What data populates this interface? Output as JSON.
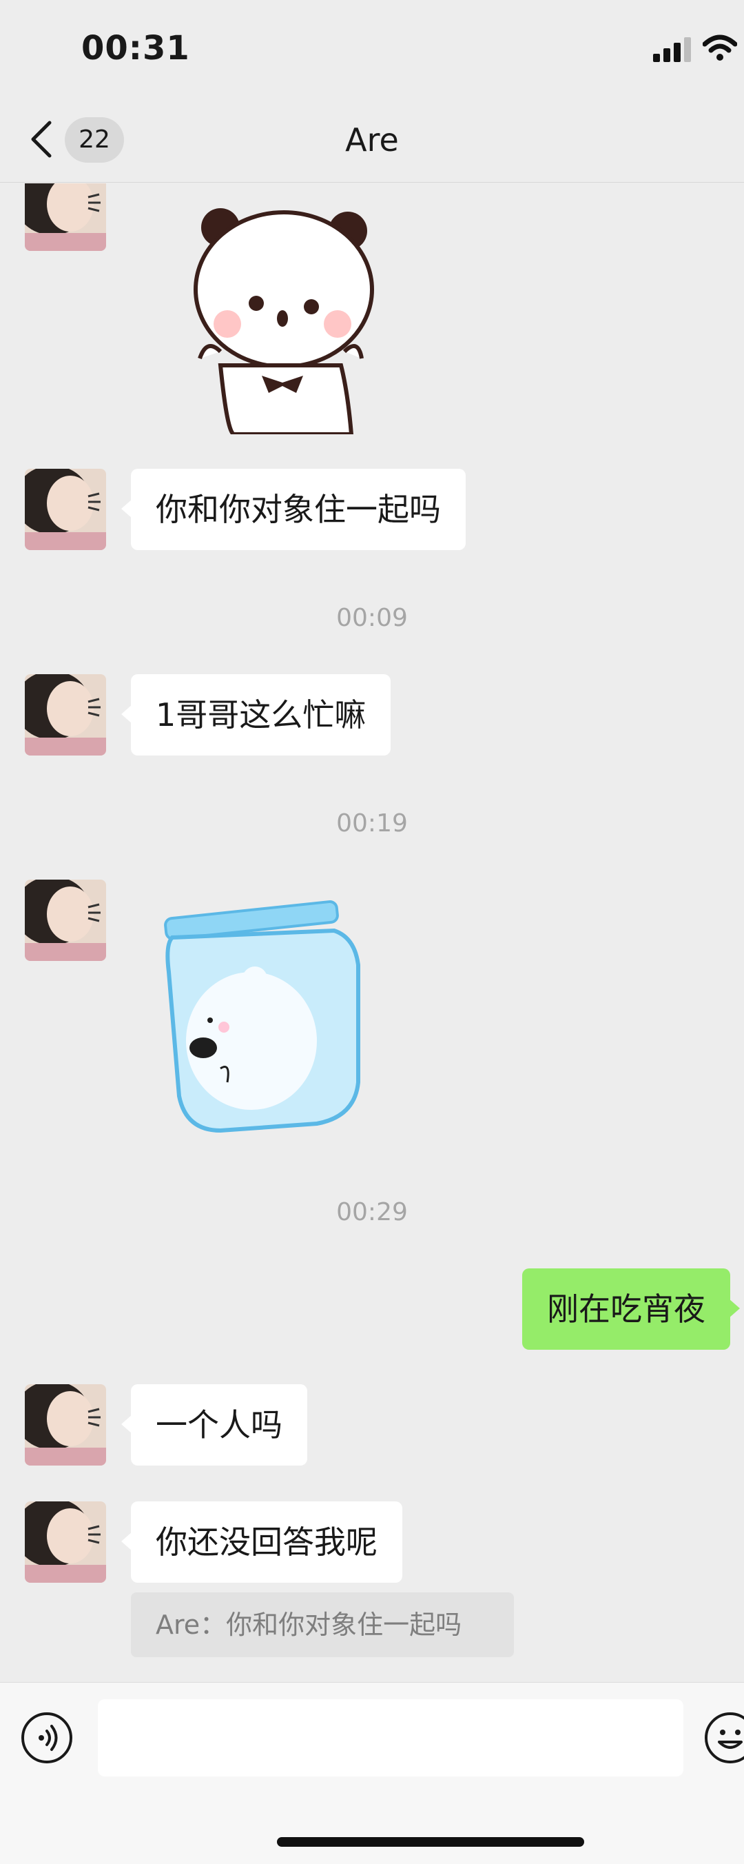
{
  "status_bar": {
    "time": "00:31"
  },
  "nav": {
    "title": "Are",
    "unread_badge": "22"
  },
  "messages": {
    "m1": "你和你对象住一起吗",
    "m2": "1哥哥这么忙嘛",
    "m3": "刚在吃宵夜",
    "m4": "一个人吗",
    "m5": "你还没回答我呢",
    "quote": "Are：你和你对象住一起吗"
  },
  "timestamps": {
    "t1": "00:09",
    "t2": "00:19",
    "t3": "00:29"
  },
  "input": {
    "value": ""
  },
  "colors": {
    "background": "#ededed",
    "incoming_bubble": "#ffffff",
    "outgoing_bubble": "#95ec69",
    "timestamp": "#a5a5a5"
  },
  "icons": [
    "back-chevron-icon",
    "voice-icon",
    "emoji-icon",
    "signal-icon",
    "wifi-icon"
  ]
}
